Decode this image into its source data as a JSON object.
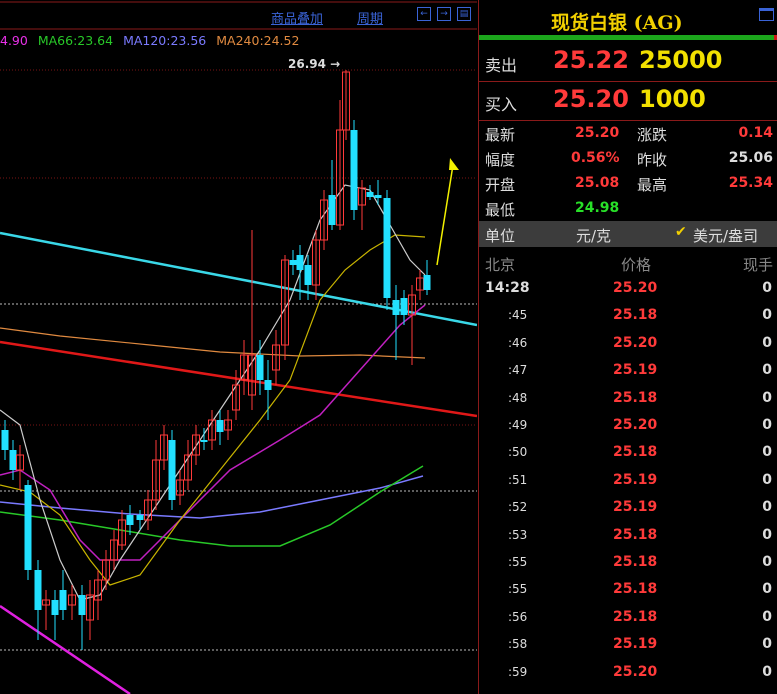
{
  "toolbar": {
    "overlay_label": "商品叠加",
    "period_label": "周期",
    "prev_icon": "←",
    "next_icon": "→",
    "layout_icon": "▤"
  },
  "ma_legend": {
    "ma_first": "4.90",
    "ma66": "MA66:23.64",
    "ma120": "MA120:23.56",
    "ma240": "MA240:24.52",
    "colors": {
      "ma_first": "#e830e8",
      "ma66": "#28c828",
      "ma120": "#7a7aff",
      "ma240": "#e08a40"
    }
  },
  "chart": {
    "peak_label": "26.94 →",
    "up_color": "#ff3a3a",
    "down_color": "#22e0ff",
    "trend_cyan": "#3ad8e8",
    "trend_red": "#e01818",
    "trend_magenta": "#e020e0",
    "arrow_color": "#f2f000"
  },
  "panel": {
    "title": "现货白银 (AG)",
    "sell_label": "卖出",
    "sell_price": "25.22",
    "sell_volume": "25000",
    "buy_label": "买入",
    "buy_price": "25.20",
    "buy_volume": "1000",
    "stats": {
      "latest_label": "最新",
      "latest": "25.20",
      "change_label": "涨跌",
      "change": "0.14",
      "range_label": "幅度",
      "range": "0.56%",
      "prev_close_label": "昨收",
      "prev_close": "25.06",
      "open_label": "开盘",
      "open": "25.08",
      "high_label": "最高",
      "high": "25.34",
      "low_label": "最低",
      "low": "24.98"
    },
    "unit": {
      "label": "单位",
      "value": "元/克",
      "check": "✔",
      "option": "美元/盎司"
    },
    "ticks_header": {
      "location": "北京",
      "price": "价格",
      "qty": "现手"
    },
    "ticks": [
      {
        "time": "14:28",
        "price": "25.20",
        "qty": "0"
      },
      {
        "time": ":45",
        "price": "25.18",
        "qty": "0"
      },
      {
        "time": ":46",
        "price": "25.20",
        "qty": "0"
      },
      {
        "time": ":47",
        "price": "25.19",
        "qty": "0"
      },
      {
        "time": ":48",
        "price": "25.18",
        "qty": "0"
      },
      {
        "time": ":49",
        "price": "25.20",
        "qty": "0"
      },
      {
        "time": ":50",
        "price": "25.18",
        "qty": "0"
      },
      {
        "time": ":51",
        "price": "25.19",
        "qty": "0"
      },
      {
        "time": ":52",
        "price": "25.19",
        "qty": "0"
      },
      {
        "time": ":53",
        "price": "25.18",
        "qty": "0"
      },
      {
        "time": ":55",
        "price": "25.18",
        "qty": "0"
      },
      {
        "time": ":55",
        "price": "25.18",
        "qty": "0"
      },
      {
        "time": ":56",
        "price": "25.18",
        "qty": "0"
      },
      {
        "time": ":58",
        "price": "25.19",
        "qty": "0"
      },
      {
        "time": ":59",
        "price": "25.20",
        "qty": "0"
      }
    ]
  }
}
